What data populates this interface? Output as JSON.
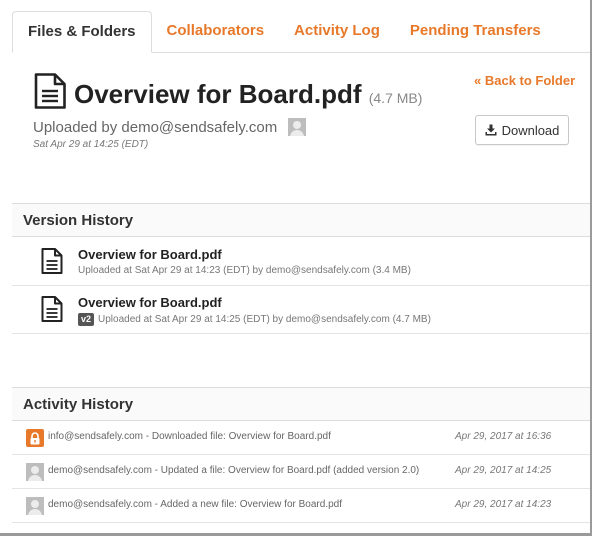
{
  "tabs": [
    {
      "label": "Files & Folders",
      "active": true
    },
    {
      "label": "Collaborators",
      "active": false
    },
    {
      "label": "Activity Log",
      "active": false
    },
    {
      "label": "Pending Transfers",
      "active": false
    }
  ],
  "file": {
    "name": "Overview for Board.pdf",
    "size": "(4.7 MB)",
    "uploaded_by": "Uploaded by demo@sendsafely.com",
    "uploaded_date": "Sat Apr 29 at 14:25 (EDT)",
    "icon": "document-icon"
  },
  "actions": {
    "back_label": "« Back to Folder",
    "download_label": "Download",
    "download_icon": "download-icon"
  },
  "version_history": {
    "title": "Version History",
    "items": [
      {
        "name": "Overview for Board.pdf",
        "badge": "",
        "meta": "Uploaded at Sat Apr 29 at 14:23 (EDT) by demo@sendsafely.com (3.4 MB)"
      },
      {
        "name": "Overview for Board.pdf",
        "badge": "v2",
        "meta": "Uploaded at Sat Apr 29 at 14:25 (EDT) by demo@sendsafely.com (4.7 MB)"
      }
    ]
  },
  "activity_history": {
    "title": "Activity History",
    "items": [
      {
        "avatar": "lock-icon",
        "text": "info@sendsafely.com - Downloaded file: Overview for Board.pdf",
        "date": "Apr 29, 2017 at 16:36"
      },
      {
        "avatar": "user-avatar",
        "text": "demo@sendsafely.com - Updated a file: Overview for Board.pdf (added version 2.0)",
        "date": "Apr 29, 2017 at 14:25"
      },
      {
        "avatar": "user-avatar",
        "text": "demo@sendsafely.com - Added a new file: Overview for Board.pdf",
        "date": "Apr 29, 2017 at 14:23"
      }
    ]
  },
  "colors": {
    "accent": "#e8792b",
    "text": "#333333",
    "muted": "#777777",
    "border": "#dddddd"
  }
}
